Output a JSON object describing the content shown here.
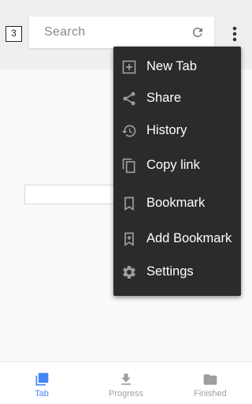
{
  "toolbar": {
    "tab_count": "3",
    "search_placeholder": "Search",
    "icons": {
      "reload": "reload-icon",
      "overflow": "more-vert-icon"
    }
  },
  "menu": {
    "items": [
      {
        "label": "New Tab",
        "icon": "new-tab-icon"
      },
      {
        "label": "Share",
        "icon": "share-icon"
      },
      {
        "label": "History",
        "icon": "history-icon"
      },
      {
        "label": "Copy link",
        "icon": "copy-icon"
      },
      {
        "label": "Bookmark",
        "icon": "bookmark-icon"
      },
      {
        "label": "Add Bookmark",
        "icon": "add-bookmark-icon"
      },
      {
        "label": "Settings",
        "icon": "settings-icon"
      }
    ]
  },
  "bottom_nav": {
    "items": [
      {
        "label": "Tab",
        "icon": "tab-icon",
        "active": true
      },
      {
        "label": "Progress",
        "icon": "download-icon",
        "active": false
      },
      {
        "label": "Finished",
        "icon": "folder-icon",
        "active": false
      }
    ]
  },
  "colors": {
    "accent": "#4285f4",
    "menu_bg": "#2b2b2b",
    "inactive": "#9e9e9e",
    "toolbar_bg": "#efefef"
  }
}
